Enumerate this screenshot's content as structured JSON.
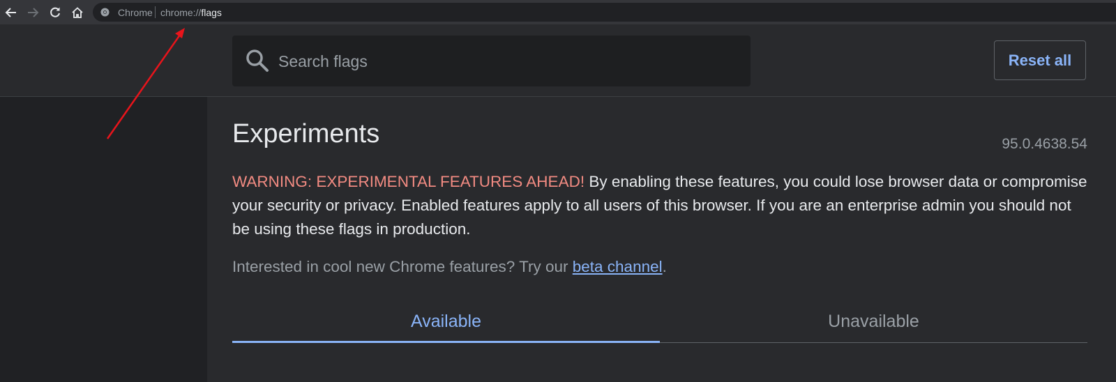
{
  "browser": {
    "site_chip": "Chrome",
    "url_scheme": "chrome://",
    "url_path": "flags"
  },
  "header": {
    "search_placeholder": "Search flags",
    "reset_label": "Reset all"
  },
  "main": {
    "title": "Experiments",
    "version": "95.0.4638.54",
    "warning_label": "WARNING: EXPERIMENTAL FEATURES AHEAD!",
    "warning_text": " By enabling these features, you could lose browser data or compromise your security or privacy. Enabled features apply to all users of this browser. If you are an enterprise admin you should not be using these flags in production.",
    "promo_text": "Interested in cool new Chrome features? Try our ",
    "promo_link": "beta channel",
    "promo_end": ".",
    "tabs": [
      {
        "label": "Available",
        "active": true
      },
      {
        "label": "Unavailable",
        "active": false
      }
    ]
  },
  "colors": {
    "accent": "#8ab4f8",
    "warning": "#f28b82",
    "annotation_arrow": "#e8141b"
  }
}
